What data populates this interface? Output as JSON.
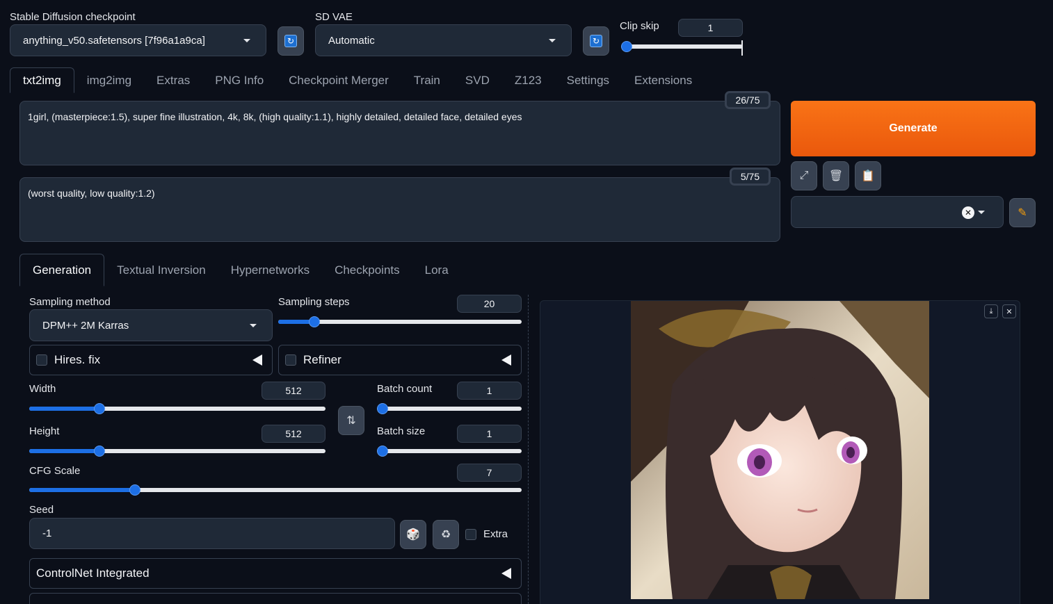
{
  "header": {
    "checkpoint_label": "Stable Diffusion checkpoint",
    "checkpoint_value": "anything_v50.safetensors [7f96a1a9ca]",
    "vae_label": "SD VAE",
    "vae_value": "Automatic",
    "clip_skip_label": "Clip skip",
    "clip_skip_value": "1",
    "clip_skip_fraction": 0.0
  },
  "main_tabs": [
    "txt2img",
    "img2img",
    "Extras",
    "PNG Info",
    "Checkpoint Merger",
    "Train",
    "SVD",
    "Z123",
    "Settings",
    "Extensions"
  ],
  "prompt": {
    "text": "1girl, (masterpiece:1.5), super fine illustration, 4k, 8k, (high quality:1.1), highly detailed, detailed face, detailed eyes",
    "counter": "26/75"
  },
  "negative_prompt": {
    "text": "(worst quality, low quality:1.2)",
    "counter": "5/75"
  },
  "generate_label": "Generate",
  "sub_tabs": [
    "Generation",
    "Textual Inversion",
    "Hypernetworks",
    "Checkpoints",
    "Lora"
  ],
  "generation": {
    "sampling_method_label": "Sampling method",
    "sampling_method_value": "DPM++ 2M Karras",
    "sampling_steps_label": "Sampling steps",
    "sampling_steps_value": "20",
    "hires_fix_label": "Hires. fix",
    "refiner_label": "Refiner",
    "width_label": "Width",
    "width_value": "512",
    "height_label": "Height",
    "height_value": "512",
    "batch_count_label": "Batch count",
    "batch_count_value": "1",
    "batch_size_label": "Batch size",
    "batch_size_value": "1",
    "cfg_label": "CFG Scale",
    "cfg_value": "7",
    "seed_label": "Seed",
    "seed_value": "-1",
    "extra_label": "Extra",
    "controlnet_label": "ControlNet Integrated"
  },
  "colors": {
    "accent": "#1d6fe5",
    "generate": "#f97316",
    "background": "#0b0f19"
  }
}
